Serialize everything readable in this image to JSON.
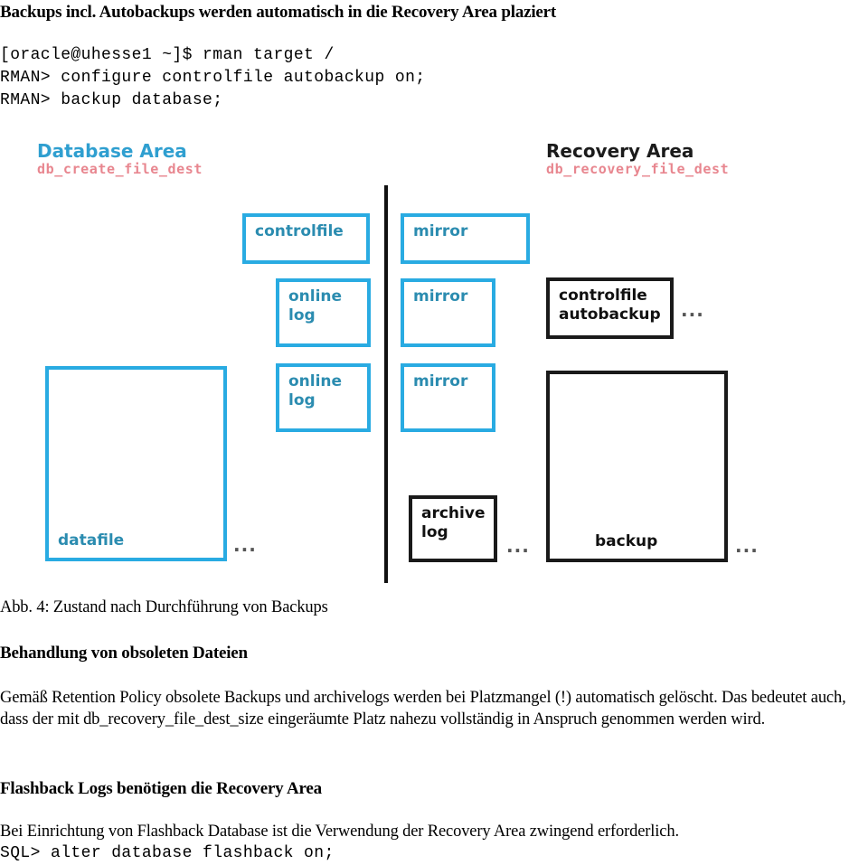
{
  "document": {
    "title_heading": "Backups incl. Autobackups werden automatisch in die Recovery Area plaziert",
    "code_block_1": [
      "[oracle@uhesse1 ~]$ rman target /",
      "RMAN> configure controlfile autobackup on;",
      "RMAN> backup database;"
    ],
    "figure_caption": "Abb. 4: Zustand nach Durchführung von Backups",
    "section_2_heading": "Behandlung von obsoleten Dateien",
    "section_2_body": "Gemäß Retention Policy obsolete Backups und archivelogs werden bei Platzmangel (!) automatisch gelöscht. Das bedeutet auch, dass der mit db_recovery_file_dest_size eingeräumte Platz nahezu vollständig in Anspruch genommen werden wird.",
    "section_3_heading": "Flashback Logs benötigen die Recovery Area",
    "section_3_body": "Bei Einrichtung von Flashback Database ist die Verwendung der Recovery Area zwingend erforderlich.",
    "code_block_2": "SQL> alter database flashback on;"
  },
  "diagram": {
    "database_area": {
      "title": "Database Area",
      "parameter": "db_create_file_dest"
    },
    "recovery_area": {
      "title": "Recovery Area",
      "parameter": "db_recovery_file_dest"
    },
    "boxes": {
      "controlfile": "controlfile",
      "online_log_1": "online\nlog",
      "online_log_2": "online\nlog",
      "datafile": "datafile",
      "mirror_1": "mirror",
      "mirror_2": "mirror",
      "mirror_3": "mirror",
      "controlfile_autobackup": "controlfile\nautobackup",
      "archive_log": "archive\nlog",
      "backup": "backup"
    },
    "ellipsis": "...",
    "colors": {
      "blue_stroke": "#29abe2",
      "blue_text": "#2b8cb0",
      "black_stroke": "#1a1a1a",
      "param_red": "#e8868f",
      "area_title_blue": "#2f9fd0"
    }
  }
}
